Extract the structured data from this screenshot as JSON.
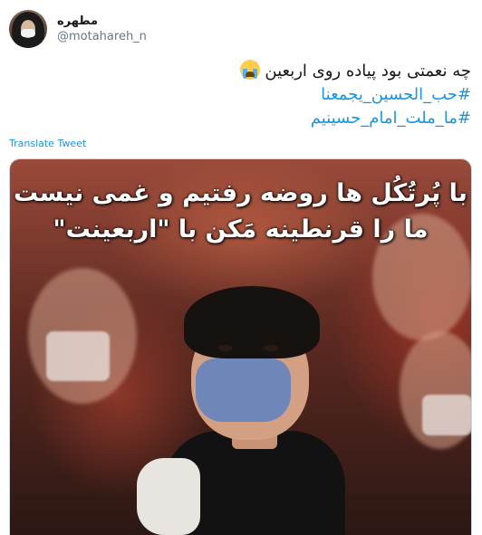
{
  "header": {
    "display_name": "مطهره",
    "handle": "@motahareh_n",
    "avatar_icon": "user-avatar"
  },
  "tweet": {
    "line1": "چه نعمتی بود پیاده روی اربعین",
    "line1_emoji": "loudly-crying-face-icon",
    "hashtag1": "#حب_الحسین_یجمعنا",
    "hashtag2": "#ما_ملت_امام_حسینیم"
  },
  "translate_label": "Translate Tweet",
  "media": {
    "overlay_line1": "با پُرتُکُل ها روضه رفتیم و غمی نیست",
    "overlay_line2": "ما را قرنطینه مَکن با \"اربعینت\""
  },
  "colors": {
    "link": "#1b95e0",
    "text": "#14171a",
    "muted": "#657786"
  }
}
